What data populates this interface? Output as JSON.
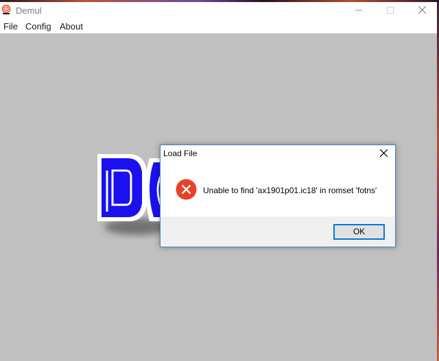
{
  "window": {
    "title": "Demul",
    "app_icon": "spiral-app-icon",
    "controls": {
      "minimize": "minimize-icon",
      "maximize": "maximize-icon",
      "close": "close-icon"
    }
  },
  "menubar": {
    "items": [
      {
        "label": "File"
      },
      {
        "label": "Config"
      },
      {
        "label": "About"
      }
    ]
  },
  "content": {
    "logo_text": "DE",
    "logo_color": "#1a10f0"
  },
  "dialog": {
    "title": "Load File",
    "icon": "error-icon",
    "message": "Unable to find 'ax1901p01.ic18' in romset 'fotns'",
    "ok_label": "OK",
    "error_color": "#e8412a",
    "focus_color": "#0078d7"
  }
}
